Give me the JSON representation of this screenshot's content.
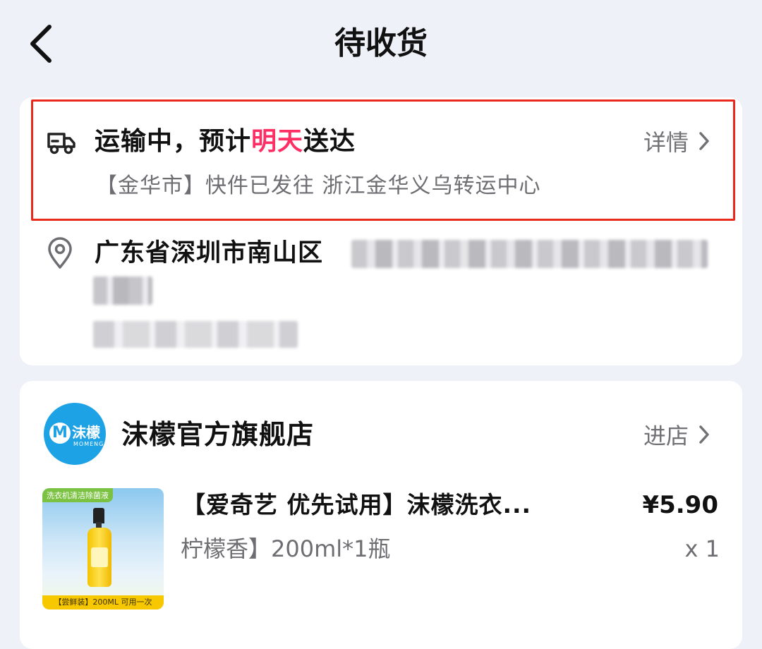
{
  "header": {
    "title": "待收货",
    "back_icon": "chevron-left-icon"
  },
  "shipping": {
    "status_prefix": "运输中，预计",
    "status_highlight": "明天",
    "status_suffix": "送达",
    "highlight_color": "#ff2e63",
    "detail_label": "详情",
    "tracking_text": "【金华市】快件已发往 浙江金华义乌转运中心",
    "frame_color": "#e8291c"
  },
  "address": {
    "text": "广东省深圳市南山区"
  },
  "shop": {
    "name": "沫檬官方旗舰店",
    "enter_label": "进店",
    "logo_letter": "M",
    "logo_cn": "沫檬",
    "logo_en": "MOMENG",
    "brand_color": "#1ea2e6"
  },
  "product": {
    "title": "【爱奇艺 优先试用】沫檬洗衣...",
    "spec": "柠檬香】200ml*1瓶",
    "price": "¥5.90",
    "quantity": "x 1",
    "image_top_tag": "洗衣机清洁除菌液",
    "image_bottom_tag": "【尝鲜装】200ML 可用一次"
  }
}
